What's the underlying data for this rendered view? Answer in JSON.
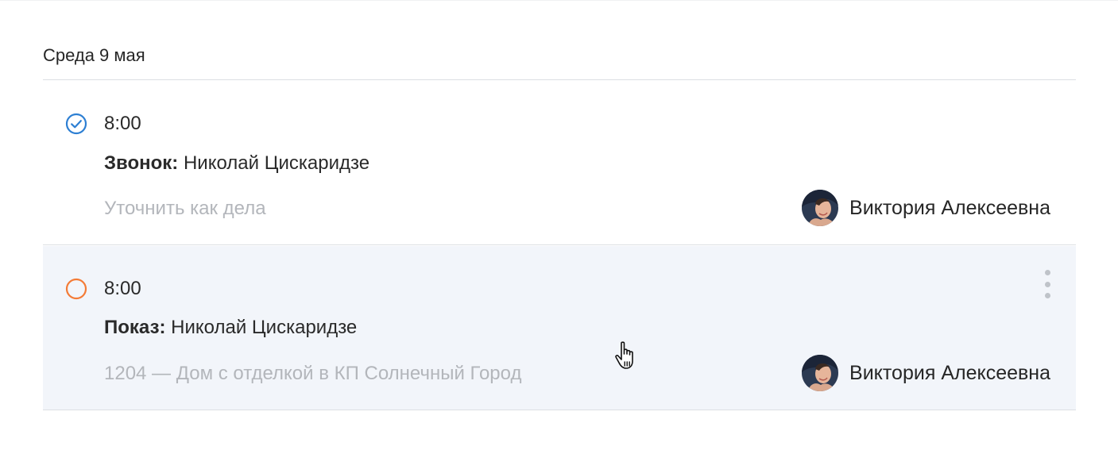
{
  "day": {
    "header": "Среда 9 мая"
  },
  "colors": {
    "done": "#2d7fd3",
    "pending": "#f47b36",
    "hover_bg": "#f2f5fa",
    "muted_text": "#b3b6bb"
  },
  "tasks": [
    {
      "status": "done",
      "status_icon": "check-circle-icon",
      "time": "8:00",
      "type": "Звонок:",
      "contact": " Николай Цискаридзе",
      "description": "Уточнить как дела",
      "assignee": "Виктория Алексеевна"
    },
    {
      "status": "pending",
      "status_icon": "empty-circle-icon",
      "time": "8:00",
      "type": "Показ:",
      "contact": " Николай Цискаридзе",
      "description": "1204 — Дом с отделкой в КП Солнечный Город",
      "assignee": "Виктория Алексеевна",
      "hovered": true,
      "menu_icon": "more-vertical-icon"
    }
  ]
}
